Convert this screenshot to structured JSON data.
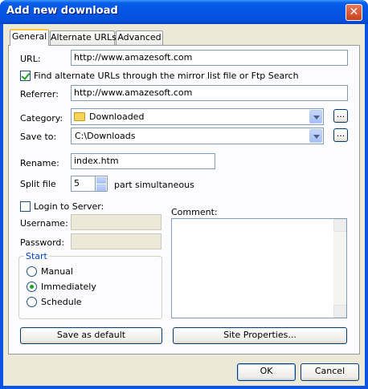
{
  "window": {
    "title": "Add new download",
    "close_symbol": "✕"
  },
  "tabs": [
    {
      "label": "General",
      "active": true
    },
    {
      "label": "Alternate URLs",
      "active": false
    },
    {
      "label": "Advanced",
      "active": false
    }
  ],
  "general": {
    "url_label": "URL:",
    "url_value": "http://www.amazesoft.com",
    "find_alternate_label": "Find alternate URLs through the mirror list file or Ftp Search",
    "find_alternate_checked": true,
    "referrer_label": "Referrer:",
    "referrer_value": "http://www.amazesoft.com",
    "category_label": "Category:",
    "category_value": "Downloaded",
    "category_icon": "folder-icon",
    "save_to_label": "Save to:",
    "save_to_value": "C:\\Downloads",
    "browse_label": "...",
    "rename_label": "Rename:",
    "rename_value": "index.htm",
    "split_label": "Split file",
    "split_value": "5",
    "split_suffix": "part simultaneous",
    "login_label": "Login to Server:",
    "login_checked": false,
    "username_label": "Username:",
    "username_value": "",
    "password_label": "Password:",
    "password_value": "",
    "comment_label": "Comment:",
    "comment_value": "",
    "start_group_label": "Start",
    "start_options": [
      {
        "label": "Manual",
        "selected": false
      },
      {
        "label": "Immediately",
        "selected": true
      },
      {
        "label": "Schedule",
        "selected": false
      }
    ],
    "save_default_label": "Save as default",
    "site_properties_label": "Site Properties..."
  },
  "footer": {
    "ok_label": "OK",
    "cancel_label": "Cancel"
  },
  "colors": {
    "titlebar": "#0554e3",
    "dialog_bg": "#ece9d8",
    "checkmark": "#21a121",
    "group_label": "#0046d5"
  }
}
